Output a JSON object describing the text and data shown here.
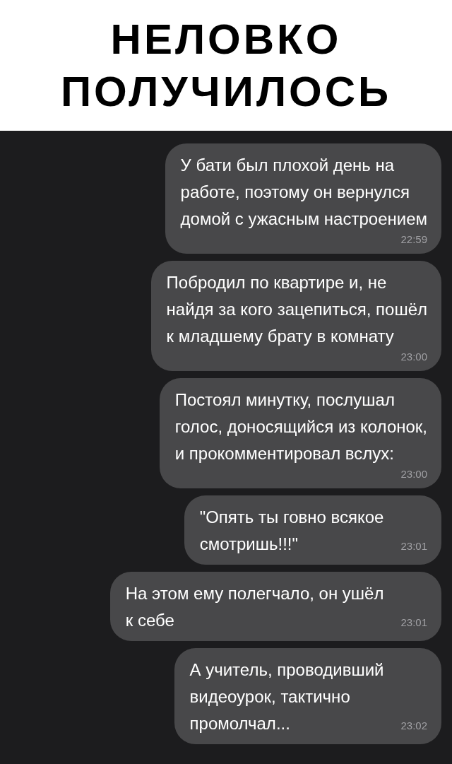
{
  "title": "НЕЛОВКО\nПОЛУЧИЛОСЬ",
  "messages": [
    {
      "kind": "time-below",
      "text": "У бати был плохой день на\nработе, поэтому он вернулся\nдомой с ужасным настроением",
      "time": "22:59"
    },
    {
      "kind": "time-below",
      "text": "Побродил по квартире и, не\nнайдя за кого зацепиться, пошёл\nк младшему брату в комнату",
      "time": "23:00"
    },
    {
      "kind": "time-below",
      "text": "Постоял минутку, послушал\nголос, доносящийся из колонок,\nи прокомментировал вслух:",
      "time": "23:00"
    },
    {
      "kind": "time-inline",
      "text": "\"Опять ты говно всякое\nсмотришь!!!\"",
      "time": "23:01"
    },
    {
      "kind": "time-inline",
      "text": "На этом ему полегчало, он ушёл\nк себе",
      "time": "23:01"
    },
    {
      "kind": "time-inline",
      "text": "А учитель, проводивший\nвидеоурок, тактично\nпромолчал...",
      "time": "23:02"
    }
  ]
}
